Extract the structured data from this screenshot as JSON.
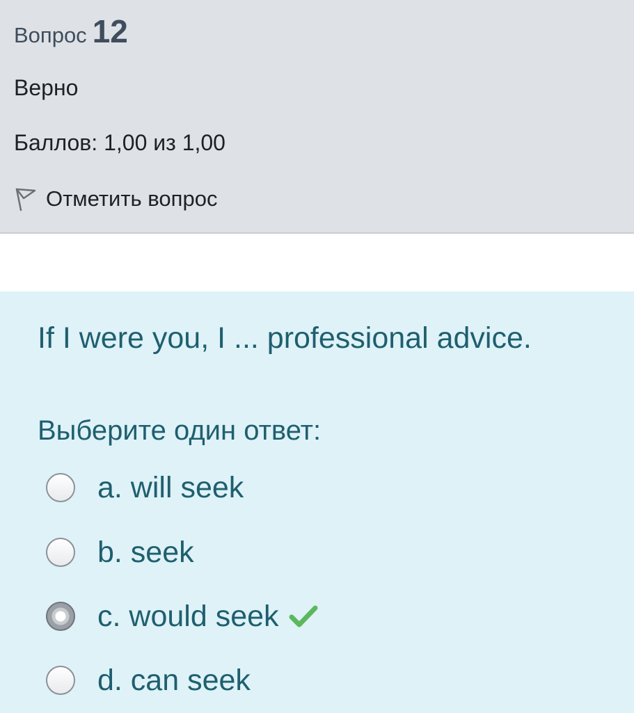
{
  "info": {
    "question_word": "Вопрос",
    "question_number": "12",
    "state": "Верно",
    "grade": "Баллов: 1,00 из 1,00",
    "flag_label": "Отметить вопрос",
    "flag_icon": "flag-outline-icon"
  },
  "formulation": {
    "question_text": "If I were you, I ... professional advice.",
    "prompt": "Выберите один ответ:",
    "options": [
      {
        "label": "a. will seek",
        "selected": false
      },
      {
        "label": "b. seek",
        "selected": false
      },
      {
        "label": "c. would seek",
        "selected": true,
        "correct_icon": "check-icon"
      },
      {
        "label": "d. can seek",
        "selected": false
      }
    ]
  },
  "colors": {
    "info_bg": "#dee2e6",
    "formulation_bg": "#def2f8",
    "text_teal": "#1f5f6e",
    "check_green": "#5cb85c"
  }
}
